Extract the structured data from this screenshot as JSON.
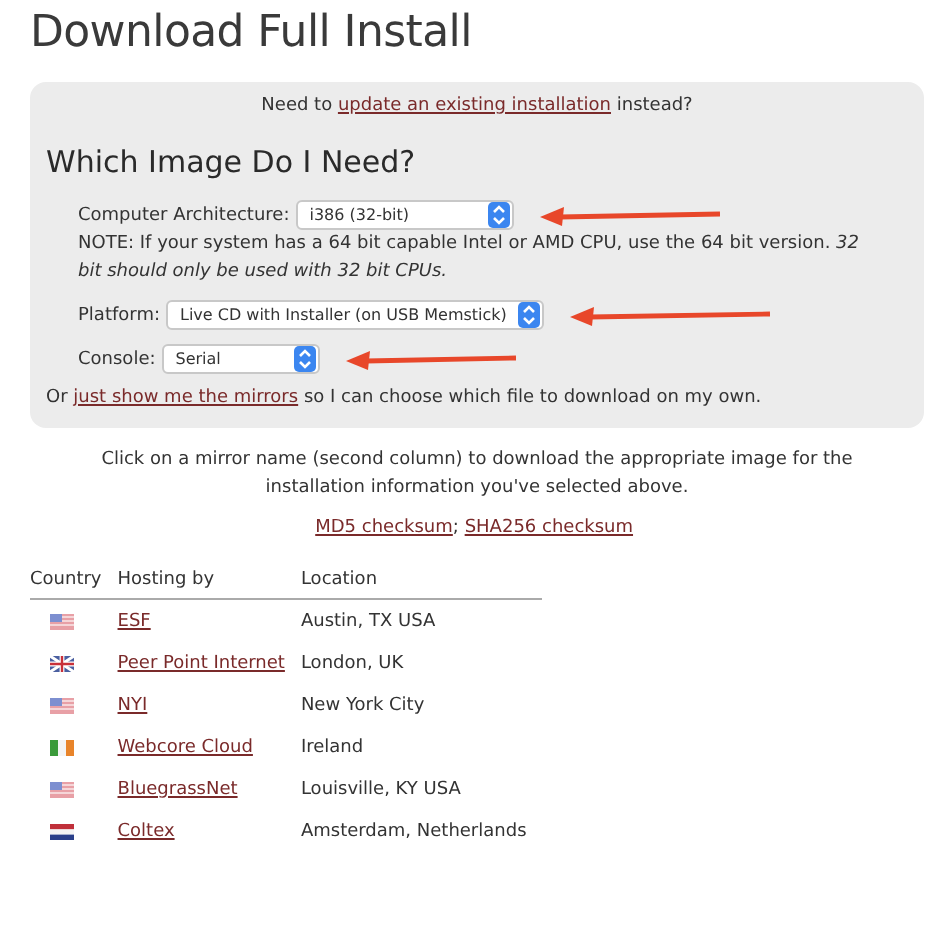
{
  "title": "Download Full Install",
  "update_notice": {
    "before": "Need to ",
    "link": "update an existing installation",
    "after": " instead?"
  },
  "section_heading": "Which Image Do I Need?",
  "selectors": [
    {
      "label": "Computer Architecture:",
      "value": "i386 (32-bit)",
      "note": "NOTE: If your system has a 64 bit capable Intel or AMD CPU, use the 64 bit version. *32 bit should only be used with 32 bit CPUs.*"
    },
    {
      "label": "Platform:",
      "value": "Live CD with Installer (on USB Memstick)"
    },
    {
      "label": "Console:",
      "value": "Serial"
    }
  ],
  "mirrors_notice": {
    "before": "Or ",
    "link": "just show me the mirrors",
    "after": " so I can choose which file to download on my own."
  },
  "instructions": "Click on a mirror name (second column) to download the appropriate image for the installation information you've selected above.",
  "checksums": [
    {
      "label": "MD5 checksum",
      "separator": ";"
    },
    {
      "label": "SHA256 checksum"
    }
  ],
  "table": {
    "columns": [
      "Country",
      "Hosting by",
      "Location"
    ],
    "rows": [
      {
        "kind": "us",
        "host": "ESF",
        "location": "Austin, TX USA"
      },
      {
        "kind": "uk",
        "host": "Peer Point Internet",
        "location": "London, UK"
      },
      {
        "kind": "us",
        "host": "NYI",
        "location": "New York City"
      },
      {
        "kind": "ie",
        "host": "Webcore Cloud",
        "location": "Ireland"
      },
      {
        "kind": "us",
        "host": "BluegrassNet",
        "location": "Louisville, KY USA"
      },
      {
        "kind": "nl",
        "host": "Coltex",
        "location": "Amsterdam, Netherlands"
      }
    ]
  }
}
